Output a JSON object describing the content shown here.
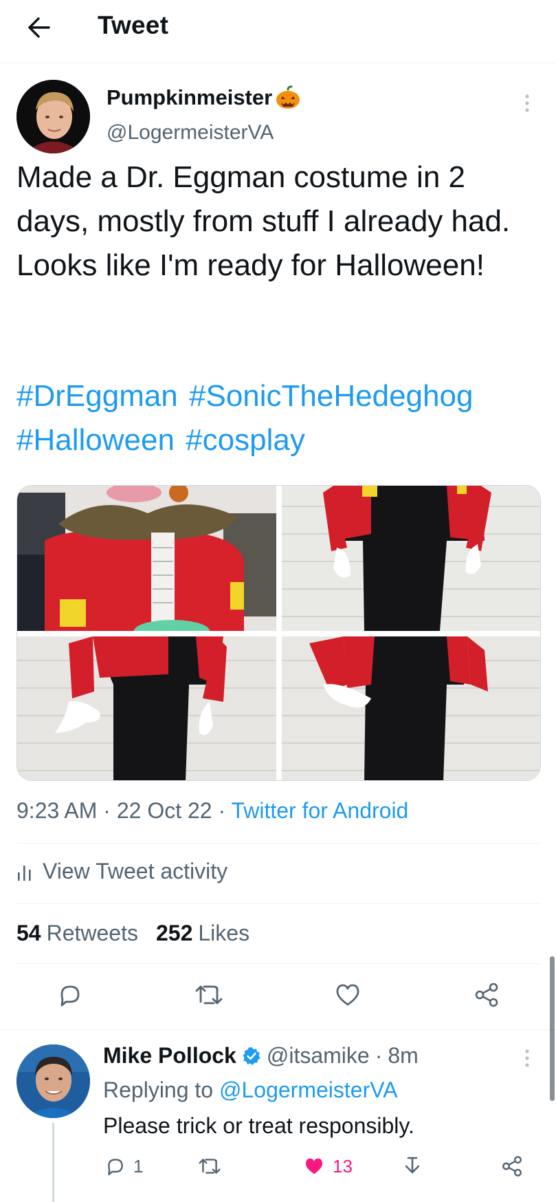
{
  "topbar": {
    "title": "Tweet",
    "back_icon": "arrow-left-icon"
  },
  "tweet": {
    "author_name": "Pumpkinmeister",
    "author_emoji": "jack-o-lantern-icon",
    "author_handle": "@LogermeisterVA",
    "text": "Made a Dr. Eggman costume in 2 days, mostly from stuff I already had. Looks like I'm ready for Halloween!",
    "hashtags": [
      "#DrEggman",
      "#SonicTheHedeghog",
      "#Halloween",
      "#cosplay"
    ],
    "media_count": 4,
    "time": "9:23 AM",
    "date": "22 Oct 22",
    "separator": "·",
    "client": "Twitter for Android",
    "activity_label": "View Tweet activity",
    "retweets_count": "54",
    "retweets_label": "Retweets",
    "likes_count": "252",
    "likes_label": "Likes"
  },
  "reply": {
    "author_name": "Mike Pollock",
    "verified": true,
    "author_handle": "@itsamike",
    "separator": "·",
    "time": "8m",
    "replying_prefix": "Replying to",
    "replying_to": "@LogermeisterVA",
    "text": "Please trick or treat responsibly.",
    "reply_count": "1",
    "like_count": "13",
    "liked": true
  },
  "colors": {
    "link": "#1d9bf0",
    "secondary_text": "#536471",
    "like_pink": "#f91880",
    "primary_text": "#0f1419"
  }
}
